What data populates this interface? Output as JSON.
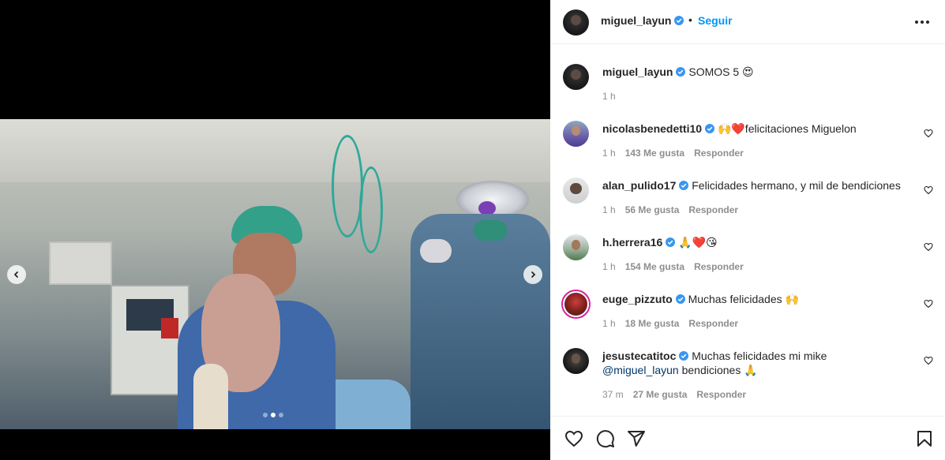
{
  "post": {
    "author": "miguel_layun",
    "follow_label": "Seguir",
    "bullet": "•",
    "caption_text": "SOMOS 5 😍",
    "caption_time": "1 h",
    "carousel": {
      "total": 3,
      "active_index": 1
    }
  },
  "comments": [
    {
      "user": "nicolasbenedetti10",
      "text": "🙌❤️felicitaciones Miguelon",
      "time": "1 h",
      "likes": "143 Me gusta",
      "reply": "Responder",
      "avatar": "purple"
    },
    {
      "user": "alan_pulido17",
      "text": "Felicidades hermano, y mil de bendiciones",
      "time": "1 h",
      "likes": "56 Me gusta",
      "reply": "Responder",
      "avatar": "gray"
    },
    {
      "user": "h.herrera16",
      "text": "🙏❤️😘",
      "time": "1 h",
      "likes": "154 Me gusta",
      "reply": "Responder",
      "avatar": "stadium"
    },
    {
      "user": "euge_pizzuto",
      "text": "Muchas felicidades 🙌",
      "time": "1 h",
      "likes": "18 Me gusta",
      "reply": "Responder",
      "avatar": "ring"
    },
    {
      "user": "jesustecatitoc",
      "text": "Muchas felicidades mi mike",
      "mention": "@miguel_layun",
      "text2": "bendiciones 🙏",
      "time": "37 m",
      "likes": "27 Me gusta",
      "reply": "Responder",
      "avatar": "black"
    }
  ],
  "icons": {
    "prev": "chevron-left-icon",
    "next": "chevron-right-icon",
    "like": "heart-icon",
    "comment": "comment-icon",
    "share": "paper-plane-icon",
    "save": "bookmark-icon",
    "verified": "verified-badge-icon",
    "more": "more-options-icon"
  },
  "colors": {
    "accent": "#0095f6",
    "verified": "#3897f0",
    "text": "#262626",
    "muted": "#8e8e8e"
  }
}
